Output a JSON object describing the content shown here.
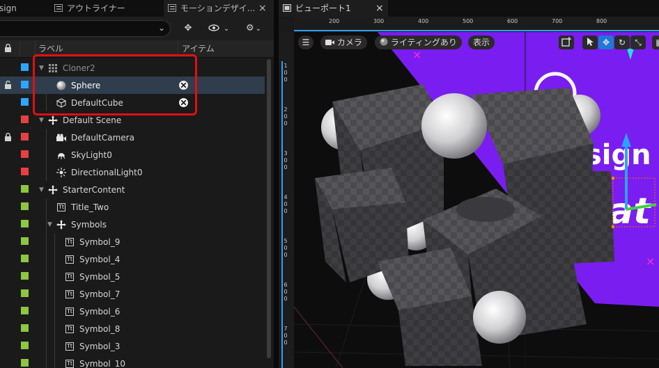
{
  "left_tabs": [
    {
      "label": "sign"
    },
    {
      "label": "アウトライナー"
    },
    {
      "label": "モーションデザイ..."
    }
  ],
  "close_glyph": "×",
  "toolbar": {
    "search_placeholder": "",
    "dropdown_glyph": "⌄",
    "transform_glyph": "✥",
    "eye_glyph": "👁",
    "gear_glyph": "⚙"
  },
  "columns": {
    "label": "ラベル",
    "item": "アイテム"
  },
  "rows": [
    {
      "label": "Cloner2",
      "color": "#2ea5ff",
      "icon": "cloner-icon",
      "depth": 0,
      "expander": "▼",
      "dim": true,
      "lock": "",
      "action": false,
      "selected": false
    },
    {
      "label": "Sphere",
      "color": "#2ea5ff",
      "icon": "sphere-icon",
      "depth": 1,
      "expander": "",
      "dim": false,
      "lock": "🔓",
      "action": true,
      "selected": true
    },
    {
      "label": "DefaultCube",
      "color": "#2ea5ff",
      "icon": "cube-icon",
      "depth": 1,
      "expander": "",
      "dim": false,
      "lock": "",
      "action": true,
      "selected": false
    },
    {
      "label": "Default Scene",
      "color": "#e84040",
      "icon": "actor-icon",
      "depth": 0,
      "expander": "▼",
      "dim": false,
      "lock": "",
      "action": false,
      "selected": false
    },
    {
      "label": "DefaultCamera",
      "color": "#e84040",
      "icon": "camera-icon",
      "depth": 1,
      "expander": "",
      "dim": false,
      "lock": "🔒",
      "action": false,
      "selected": false
    },
    {
      "label": "SkyLight0",
      "color": "#e84040",
      "icon": "skylight-icon",
      "depth": 1,
      "expander": "",
      "dim": false,
      "lock": "",
      "action": false,
      "selected": false
    },
    {
      "label": "DirectionalLight0",
      "color": "#e84040",
      "icon": "sun-icon",
      "depth": 1,
      "expander": "",
      "dim": false,
      "lock": "",
      "action": false,
      "selected": false
    },
    {
      "label": "StarterContent",
      "color": "#8dc63f",
      "icon": "actor-icon",
      "depth": 0,
      "expander": "▼",
      "dim": false,
      "lock": "",
      "action": false,
      "selected": false
    },
    {
      "label": "Title_Two",
      "color": "#8dc63f",
      "icon": "text-icon",
      "depth": 1,
      "expander": "",
      "dim": false,
      "lock": "",
      "action": false,
      "selected": false
    },
    {
      "label": "Symbols",
      "color": "#8dc63f",
      "icon": "actor-icon",
      "depth": 1,
      "expander": "▼",
      "dim": false,
      "lock": "",
      "action": false,
      "selected": false
    },
    {
      "label": "Symbol_9",
      "color": "#8dc63f",
      "icon": "text-icon",
      "depth": 2,
      "expander": "",
      "dim": false,
      "lock": "",
      "action": false,
      "selected": false
    },
    {
      "label": "Symbol_4",
      "color": "#8dc63f",
      "icon": "text-icon",
      "depth": 2,
      "expander": "",
      "dim": false,
      "lock": "",
      "action": false,
      "selected": false
    },
    {
      "label": "Symbol_5",
      "color": "#8dc63f",
      "icon": "text-icon",
      "depth": 2,
      "expander": "",
      "dim": false,
      "lock": "",
      "action": false,
      "selected": false
    },
    {
      "label": "Symbol_7",
      "color": "#8dc63f",
      "icon": "text-icon",
      "depth": 2,
      "expander": "",
      "dim": false,
      "lock": "",
      "action": false,
      "selected": false
    },
    {
      "label": "Symbol_6",
      "color": "#8dc63f",
      "icon": "text-icon",
      "depth": 2,
      "expander": "",
      "dim": false,
      "lock": "",
      "action": false,
      "selected": false
    },
    {
      "label": "Symbol_8",
      "color": "#8dc63f",
      "icon": "text-icon",
      "depth": 2,
      "expander": "",
      "dim": false,
      "lock": "",
      "action": false,
      "selected": false
    },
    {
      "label": "Symbol_3",
      "color": "#8dc63f",
      "icon": "text-icon",
      "depth": 2,
      "expander": "",
      "dim": false,
      "lock": "",
      "action": false,
      "selected": false
    },
    {
      "label": "Symbol_10",
      "color": "#8dc63f",
      "icon": "text-icon",
      "depth": 2,
      "expander": "",
      "dim": false,
      "lock": "",
      "action": false,
      "selected": false
    }
  ],
  "text_icon_glyph": "Tt",
  "viewport": {
    "tab_label": "ビューポート1",
    "ruler_h": [
      "200",
      "300",
      "400",
      "500",
      "600",
      "700",
      "800"
    ],
    "ruler_v": [
      "1\n0\n0",
      "2\n0\n0",
      "3\n0\n0",
      "4\n0\n0",
      "5\n0\n0",
      "6\n0\n0",
      "7\n0\n0"
    ],
    "menu_glyph": "☰",
    "camera_label": "カメラ",
    "lighting_label": "ライティングあり",
    "show_label": "表示",
    "scene_text_1": "sign",
    "scene_text_2": "at",
    "colors": {
      "backdrop": "#7a1df0",
      "accent": "#2aa2ff",
      "magenta": "#ff2fd6"
    }
  }
}
